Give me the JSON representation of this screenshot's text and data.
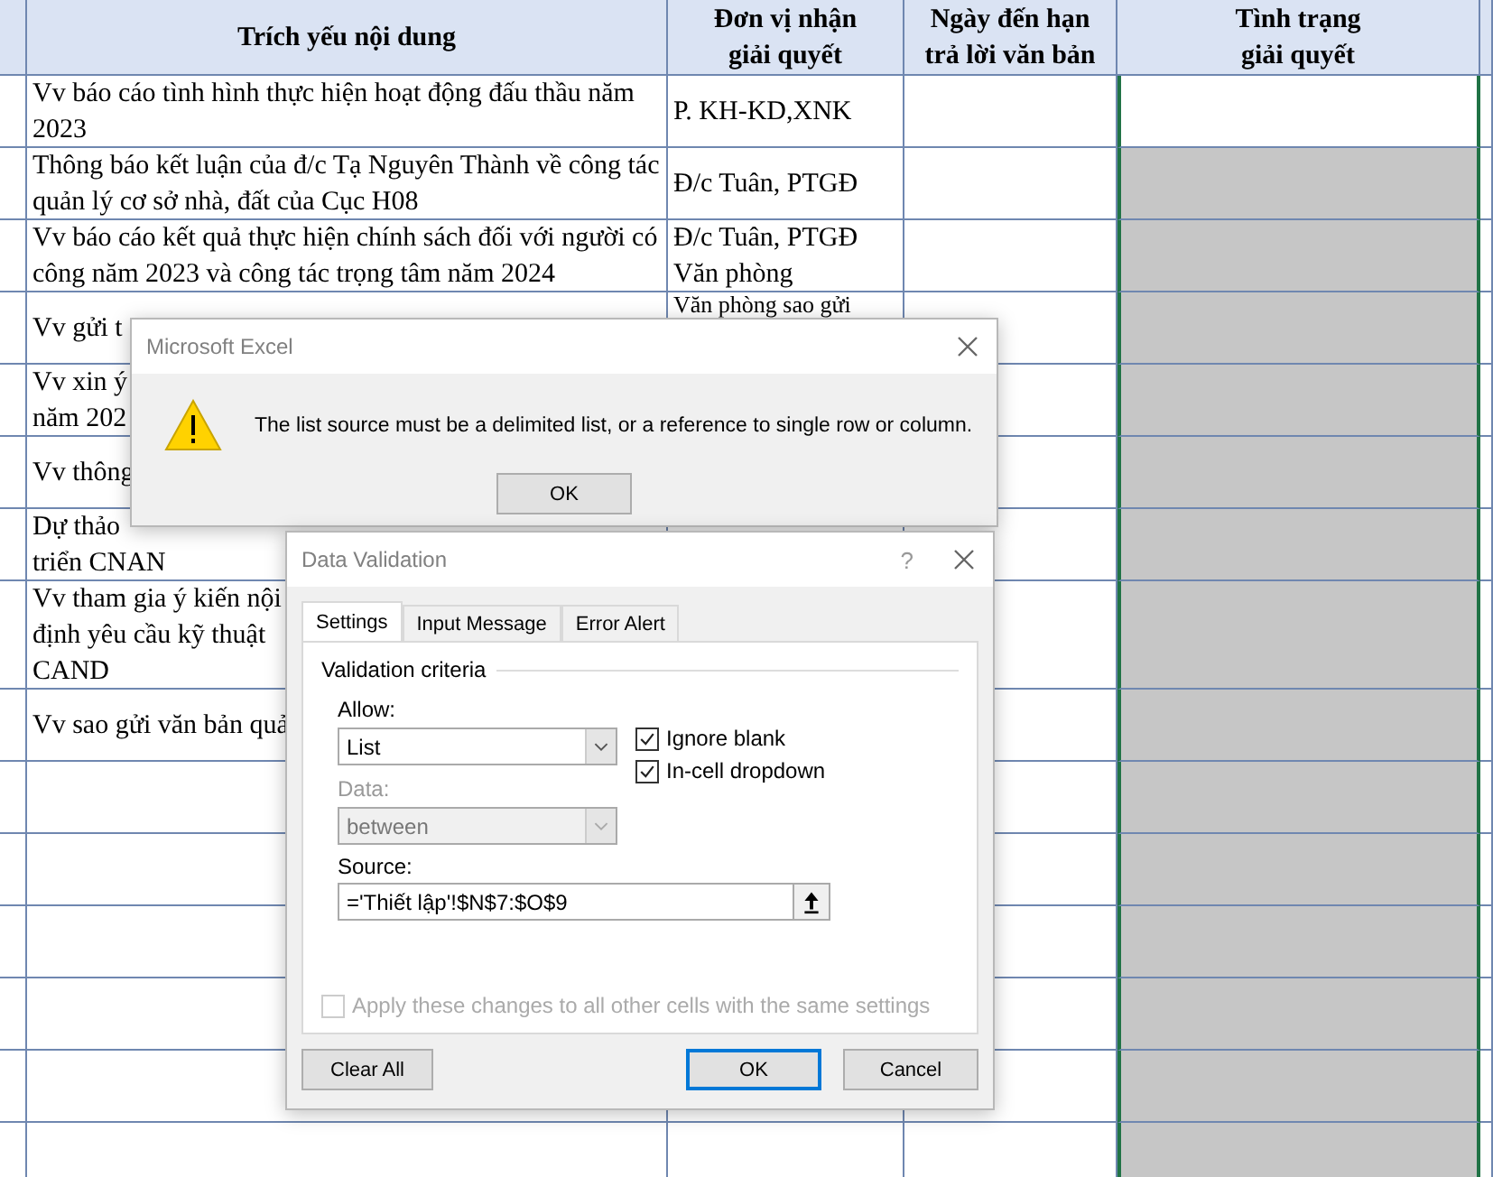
{
  "sheet": {
    "columns": [
      "Trích yếu nội dung",
      "Đơn vị nhận\ngiải quyết",
      "Ngày đến hạn\ntrả lời văn bản",
      "Tình trạng\ngiải quyết"
    ],
    "rows": [
      {
        "content": "Vv báo cáo tình hình thực hiện hoạt động đấu thầu năm 2023",
        "unit": "P. KH-KD,XNK",
        "status_shaded": false
      },
      {
        "content": "Thông báo kết luận của đ/c Tạ Nguyên Thành về công tác quản lý cơ sở nhà, đất của Cục H08",
        "unit": "Đ/c Tuân, PTGĐ",
        "status_shaded": true
      },
      {
        "content": "Vv báo cáo kết quả thực hiện chính sách đối với người có công năm 2023 và công tác trọng tâm năm 2024",
        "unit": "Đ/c Tuân, PTGĐ\nVăn phòng",
        "status_shaded": true
      },
      {
        "content": "Vv gửi t",
        "unit": "Văn phòng sao gửi",
        "status_shaded": true
      },
      {
        "content": "Vv xin ý\nnăm 202",
        "status_shaded": true
      },
      {
        "content": "Vv thông",
        "status_shaded": true
      },
      {
        "content": "Dự thảo\ntriển CNAN",
        "status_shaded": true
      },
      {
        "content": "Vv tham gia ý kiến nội\nđịnh yêu cầu kỹ thuật\nCAND",
        "status_shaded": true,
        "tall": true
      },
      {
        "content": "Vv sao gửi văn bản quả",
        "status_shaded": true
      },
      {
        "status_shaded": true
      },
      {
        "status_shaded": true
      },
      {
        "status_shaded": true
      },
      {
        "status_shaded": true
      },
      {
        "status_shaded": true
      },
      {
        "status_shaded": true
      }
    ]
  },
  "alert": {
    "title": "Microsoft Excel",
    "message": "The list source must be a delimited list, or a reference to single row or column.",
    "button": "OK"
  },
  "validation": {
    "title": "Data Validation",
    "help": "?",
    "tabs": [
      {
        "label": "Settings",
        "selected": true
      },
      {
        "label": "Input Message",
        "selected": false
      },
      {
        "label": "Error Alert",
        "selected": false
      }
    ],
    "section": "Validation criteria",
    "allow": {
      "label": "Allow:",
      "value": "List",
      "disabled": false
    },
    "data": {
      "label": "Data:",
      "value": "between",
      "disabled": true
    },
    "checkboxes": [
      {
        "label": "Ignore blank",
        "checked": true
      },
      {
        "label": "In-cell dropdown",
        "checked": true
      }
    ],
    "source": {
      "label": "Source:",
      "value": "='Thiết lập'!$N$7:$O$9"
    },
    "apply": {
      "label": "Apply these changes to all other cells with the same settings",
      "checked": false,
      "disabled": true
    },
    "buttons": [
      {
        "label": "Clear All",
        "default": false
      },
      {
        "label": "OK",
        "default": true
      },
      {
        "label": "Cancel",
        "default": false
      }
    ]
  }
}
